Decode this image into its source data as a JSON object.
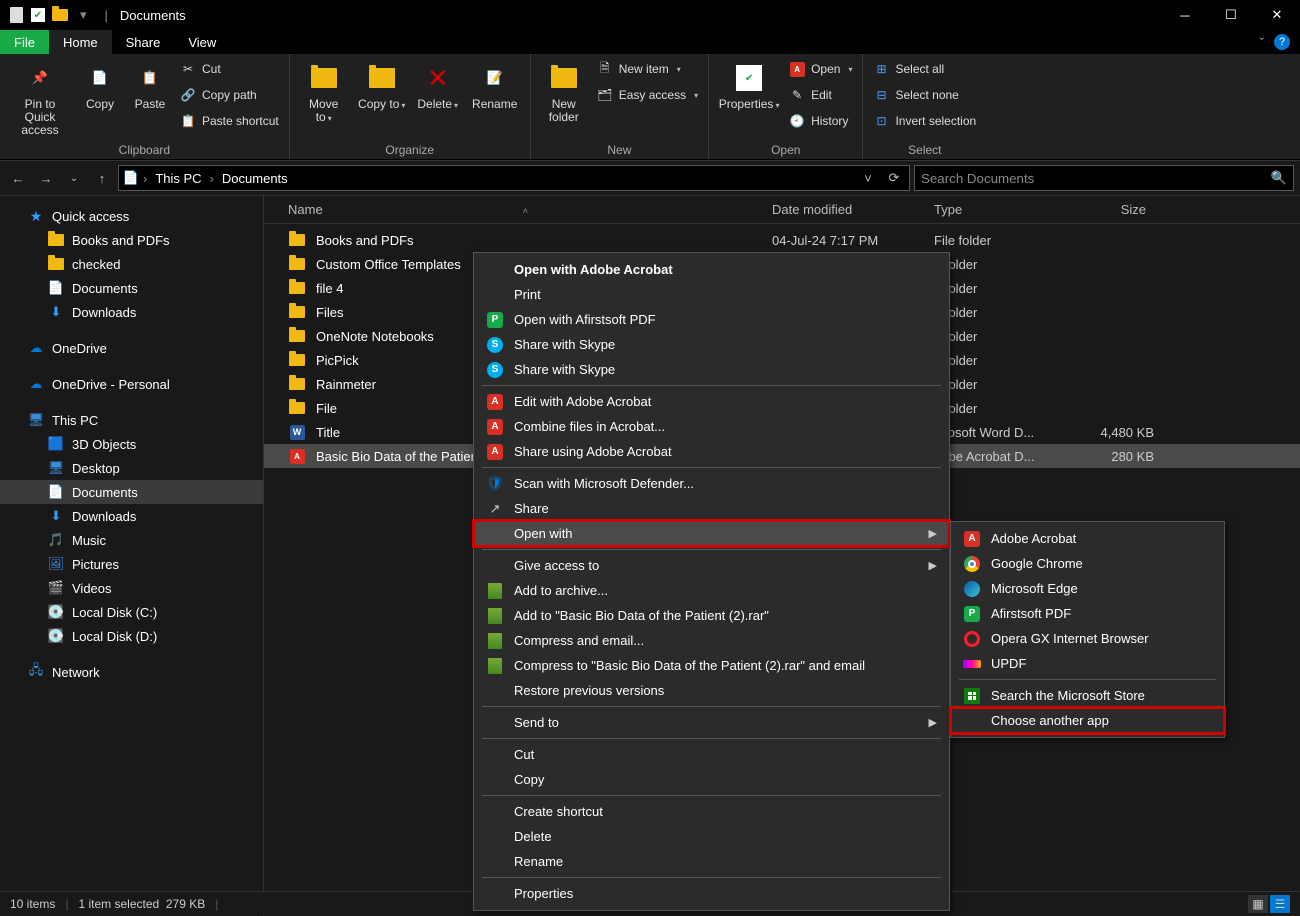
{
  "titlebar": {
    "title": "Documents"
  },
  "menu": {
    "file": "File",
    "home": "Home",
    "share": "Share",
    "view": "View"
  },
  "ribbon": {
    "clipboard": {
      "label": "Clipboard",
      "pin": "Pin to Quick access",
      "copy": "Copy",
      "paste": "Paste",
      "cut": "Cut",
      "copy_path": "Copy path",
      "paste_shortcut": "Paste shortcut"
    },
    "organize": {
      "label": "Organize",
      "move_to": "Move to",
      "copy_to": "Copy to",
      "delete": "Delete",
      "rename": "Rename"
    },
    "new": {
      "label": "New",
      "new_folder": "New folder",
      "new_item": "New item",
      "easy_access": "Easy access"
    },
    "open": {
      "label": "Open",
      "properties": "Properties",
      "open": "Open",
      "edit": "Edit",
      "history": "History"
    },
    "select": {
      "label": "Select",
      "select_all": "Select all",
      "select_none": "Select none",
      "invert": "Invert selection"
    }
  },
  "breadcrumb": {
    "root": "This PC",
    "current": "Documents"
  },
  "search": {
    "placeholder": "Search Documents"
  },
  "sidebar": {
    "quick_access": "Quick access",
    "qa_items": [
      "Books and PDFs",
      "checked",
      "Documents",
      "Downloads"
    ],
    "onedrive": "OneDrive",
    "onedrive_personal": "OneDrive - Personal",
    "this_pc": "This PC",
    "pc_items": [
      "3D Objects",
      "Desktop",
      "Documents",
      "Downloads",
      "Music",
      "Pictures",
      "Videos",
      "Local Disk (C:)",
      "Local Disk (D:)"
    ],
    "network": "Network"
  },
  "columns": {
    "name": "Name",
    "date": "Date modified",
    "type": "Type",
    "size": "Size"
  },
  "rows": [
    {
      "icon": "folder",
      "name": "Books and PDFs",
      "date": "04-Jul-24 7:17 PM",
      "type": "File folder",
      "size": ""
    },
    {
      "icon": "folder",
      "name": "Custom Office Templates",
      "date": "",
      "type": "e folder",
      "size": ""
    },
    {
      "icon": "folder",
      "name": "file 4",
      "date": "",
      "type": "e folder",
      "size": ""
    },
    {
      "icon": "folder",
      "name": "Files",
      "date": "",
      "type": "e folder",
      "size": ""
    },
    {
      "icon": "folder",
      "name": "OneNote Notebooks",
      "date": "",
      "type": "e folder",
      "size": ""
    },
    {
      "icon": "folder",
      "name": "PicPick",
      "date": "",
      "type": "e folder",
      "size": ""
    },
    {
      "icon": "folder",
      "name": "Rainmeter",
      "date": "",
      "type": "e folder",
      "size": ""
    },
    {
      "icon": "folder",
      "name": "File",
      "date": "",
      "type": "e folder",
      "size": ""
    },
    {
      "icon": "word",
      "name": "Title",
      "date": "",
      "type": "icrosoft Word D...",
      "size": "4,480 KB"
    },
    {
      "icon": "pdf",
      "name": "Basic Bio Data of the Patien",
      "date": "",
      "type": "dobe Acrobat D...",
      "size": "280 KB"
    }
  ],
  "context_menu": [
    {
      "type": "item",
      "bold": true,
      "icon": "",
      "label": "Open with Adobe Acrobat"
    },
    {
      "type": "item",
      "icon": "",
      "label": "Print"
    },
    {
      "type": "item",
      "icon": "afirst",
      "label": "Open with Afirstsoft PDF"
    },
    {
      "type": "item",
      "icon": "skype",
      "label": "Share with Skype"
    },
    {
      "type": "item",
      "icon": "skype",
      "label": "Share with Skype"
    },
    {
      "type": "sep"
    },
    {
      "type": "item",
      "icon": "acrobat",
      "label": "Edit with Adobe Acrobat"
    },
    {
      "type": "item",
      "icon": "acrobat",
      "label": "Combine files in Acrobat..."
    },
    {
      "type": "item",
      "icon": "acrobat",
      "label": "Share using Adobe Acrobat"
    },
    {
      "type": "sep"
    },
    {
      "type": "item",
      "icon": "defender",
      "label": "Scan with Microsoft Defender..."
    },
    {
      "type": "item",
      "icon": "share",
      "label": "Share"
    },
    {
      "type": "item",
      "icon": "",
      "label": "Open with",
      "arrow": true,
      "highlighted": true,
      "boxed": true
    },
    {
      "type": "sep"
    },
    {
      "type": "item",
      "icon": "",
      "label": "Give access to",
      "arrow": true
    },
    {
      "type": "item",
      "icon": "rar",
      "label": "Add to archive..."
    },
    {
      "type": "item",
      "icon": "rar",
      "label": "Add to \"Basic Bio Data of the Patient (2).rar\""
    },
    {
      "type": "item",
      "icon": "rar",
      "label": "Compress and email..."
    },
    {
      "type": "item",
      "icon": "rar",
      "label": "Compress to \"Basic Bio Data of the Patient (2).rar\" and email"
    },
    {
      "type": "item",
      "icon": "",
      "label": "Restore previous versions"
    },
    {
      "type": "sep"
    },
    {
      "type": "item",
      "icon": "",
      "label": "Send to",
      "arrow": true
    },
    {
      "type": "sep"
    },
    {
      "type": "item",
      "icon": "",
      "label": "Cut"
    },
    {
      "type": "item",
      "icon": "",
      "label": "Copy"
    },
    {
      "type": "sep"
    },
    {
      "type": "item",
      "icon": "",
      "label": "Create shortcut"
    },
    {
      "type": "item",
      "icon": "",
      "label": "Delete"
    },
    {
      "type": "item",
      "icon": "",
      "label": "Rename"
    },
    {
      "type": "sep"
    },
    {
      "type": "item",
      "icon": "",
      "label": "Properties"
    }
  ],
  "submenu": [
    {
      "type": "item",
      "icon": "acrobat",
      "label": "Adobe Acrobat"
    },
    {
      "type": "item",
      "icon": "chrome",
      "label": "Google Chrome"
    },
    {
      "type": "item",
      "icon": "edge",
      "label": "Microsoft Edge"
    },
    {
      "type": "item",
      "icon": "afirst",
      "label": "Afirstsoft PDF"
    },
    {
      "type": "item",
      "icon": "opera",
      "label": "Opera GX Internet Browser"
    },
    {
      "type": "item",
      "icon": "updf",
      "label": "UPDF"
    },
    {
      "type": "sep"
    },
    {
      "type": "item",
      "icon": "store",
      "label": "Search the Microsoft Store"
    },
    {
      "type": "item",
      "icon": "",
      "label": "Choose another app",
      "boxed": true
    }
  ],
  "status": {
    "items": "10 items",
    "selected": "1 item selected",
    "size": "279 KB"
  }
}
